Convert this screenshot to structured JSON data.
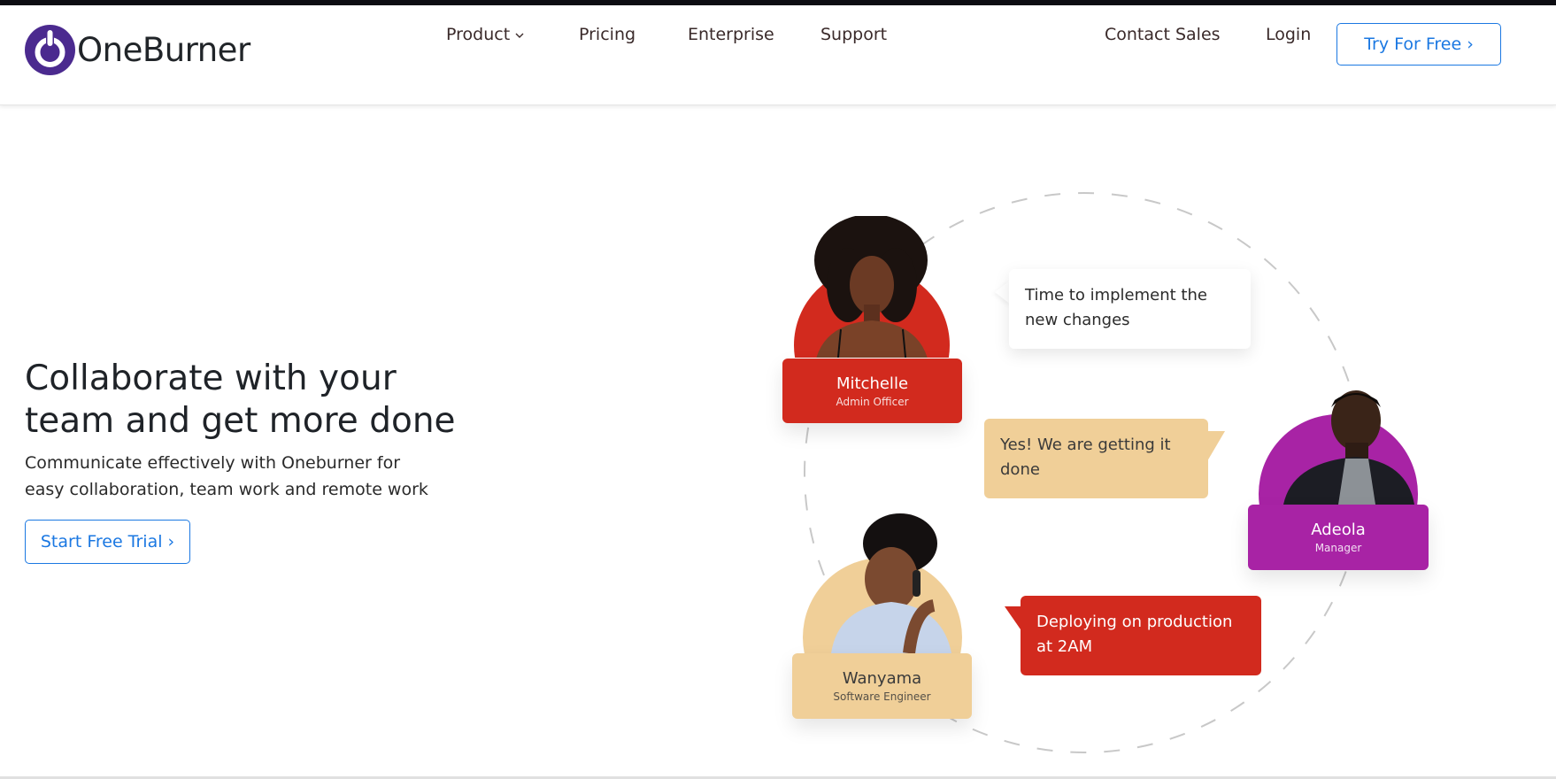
{
  "brand": {
    "name": "OneBurner",
    "color": "#4b2a8f",
    "icon": "power-logo-icon"
  },
  "nav": {
    "product": "Product",
    "pricing": "Pricing",
    "enterprise": "Enterprise",
    "support": "Support",
    "contact_sales": "Contact Sales",
    "login": "Login",
    "try_free": "Try For Free ›"
  },
  "hero": {
    "title": "Collaborate with your team and get more done",
    "subtitle": "Communicate effectively with Oneburner for easy collaboration, team work and remote work",
    "cta": "Start Free Trial ›"
  },
  "illustration": {
    "people": [
      {
        "name": "Mitchelle",
        "role": "Admin Officer",
        "color": "#d22a1e"
      },
      {
        "name": "Adeola",
        "role": "Manager",
        "color": "#a823a5"
      },
      {
        "name": "Wanyama",
        "role": "Software Engineer",
        "color": "#f0cf98"
      }
    ],
    "messages": [
      {
        "text": "Time to implement the new changes",
        "color": "#ffffff"
      },
      {
        "text": "Yes! We are getting it done",
        "color": "#f0cf98"
      },
      {
        "text": "Deploying on production at 2AM",
        "color": "#d22a1e"
      }
    ]
  },
  "colors": {
    "accent": "#1b78e2"
  }
}
